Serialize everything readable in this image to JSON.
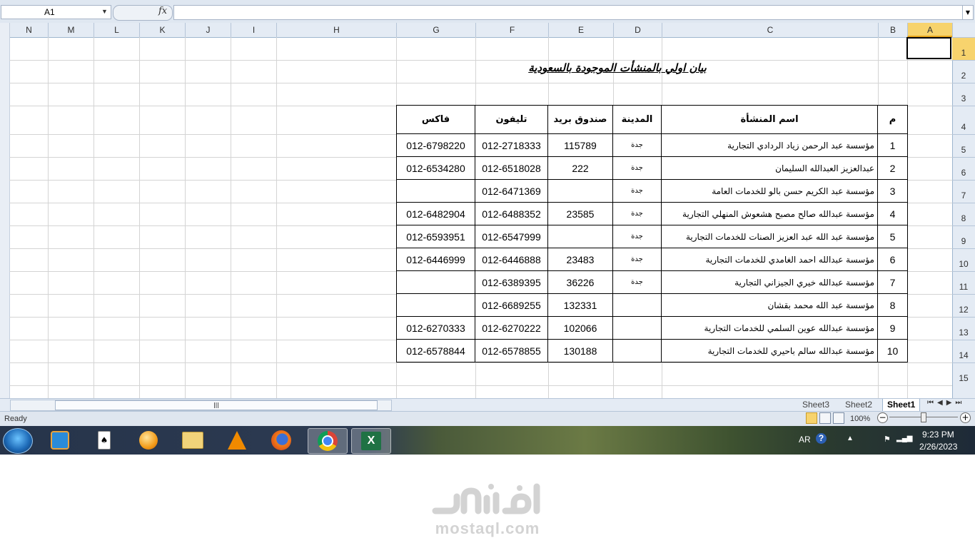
{
  "formula_bar": {
    "name_box": "A1",
    "fx_label": "fx",
    "formula": ""
  },
  "columns": [
    {
      "id": "N"
    },
    {
      "id": "M"
    },
    {
      "id": "L"
    },
    {
      "id": "K"
    },
    {
      "id": "J"
    },
    {
      "id": "I"
    },
    {
      "id": "H"
    },
    {
      "id": "G"
    },
    {
      "id": "F"
    },
    {
      "id": "E"
    },
    {
      "id": "D"
    },
    {
      "id": "C"
    },
    {
      "id": "B"
    },
    {
      "id": "A",
      "selected": true
    }
  ],
  "rows": [
    "1",
    "2",
    "3",
    "4",
    "5",
    "6",
    "7",
    "8",
    "9",
    "10",
    "11",
    "12",
    "13",
    "14",
    "15"
  ],
  "sheet": {
    "title": "بيان اولي  بالمنشأت الموجودة بالسعودية",
    "headers": {
      "index": "م",
      "name": "اسم المنشأة",
      "city": "المدينة",
      "po_box": "صندوق بريد",
      "phone": "تليفون",
      "fax": "فاكس"
    },
    "records": [
      {
        "index": "1",
        "name": "مؤسسة عبد الرحمن زياد الردادي التجارية",
        "city": "جدة",
        "po_box": "115789",
        "phone": "012-2718333",
        "fax": "012-6798220"
      },
      {
        "index": "2",
        "name": "عبدالعزيز العبدالله السليمان",
        "city": "جدة",
        "po_box": "222",
        "phone": "012-6518028",
        "fax": "012-6534280"
      },
      {
        "index": "3",
        "name": "مؤسسة عبد الكريم حسن بالو للخدمات العامة",
        "city": "جدة",
        "po_box": "",
        "phone": "012-6471369",
        "fax": ""
      },
      {
        "index": "4",
        "name": "مؤسسة عبدالله صالح مصبح هشعوش المنهلي التجارية",
        "city": "جدة",
        "po_box": "23585",
        "phone": "012-6488352",
        "fax": "012-6482904"
      },
      {
        "index": "5",
        "name": "مؤسسة عبد الله عبد العزيز الصنات للخدمات التجارية",
        "city": "جدة",
        "po_box": "",
        "phone": "012-6547999",
        "fax": "012-6593951"
      },
      {
        "index": "6",
        "name": "مؤسسة عبدالله احمد الغامدي للخدمات التجارية",
        "city": "جدة",
        "po_box": "23483",
        "phone": "012-6446888",
        "fax": "012-6446999"
      },
      {
        "index": "7",
        "name": "مؤسسة عبدالله خيري الجيزاني التجارية",
        "city": "جدة",
        "po_box": "36226",
        "phone": "012-6389395",
        "fax": ""
      },
      {
        "index": "8",
        "name": "مؤسسة عبد الله محمد بقشان",
        "city": "",
        "po_box": "132331",
        "phone": "012-6689255",
        "fax": ""
      },
      {
        "index": "9",
        "name": "مؤسسة عبدالله عوين السلمي للخدمات التجارية",
        "city": "",
        "po_box": "102066",
        "phone": "012-6270222",
        "fax": "012-6270333"
      },
      {
        "index": "10",
        "name": "مؤسسة عبدالله سالم باحيري للخدمات التجارية",
        "city": "",
        "po_box": "130188",
        "phone": "012-6578855",
        "fax": "012-6578844"
      }
    ]
  },
  "sheet_tabs": [
    {
      "label": "Sheet3"
    },
    {
      "label": "Sheet2"
    },
    {
      "label": "Sheet1",
      "active": true
    }
  ],
  "status_bar": {
    "status": "Ready",
    "zoom": "100%"
  },
  "taskbar": {
    "apps": [
      {
        "icon": "windows-media-center-icon"
      },
      {
        "icon": "solitaire-icon"
      },
      {
        "icon": "photo-viewer-icon"
      },
      {
        "icon": "file-explorer-icon"
      },
      {
        "icon": "vlc-icon"
      },
      {
        "icon": "firefox-icon"
      },
      {
        "icon": "chrome-icon",
        "active": true
      },
      {
        "icon": "excel-icon",
        "active": true
      }
    ],
    "language": "AR",
    "time": "9:23 PM",
    "date": "2/26/2023"
  },
  "watermark": {
    "logo_text": "مستقل",
    "url": "mostaql.com"
  },
  "colors": {
    "header_bg": "#e4ebf4",
    "selected_header": "#f7d36d",
    "grid": "#d4d4d4",
    "excel_green": "#1f7244"
  }
}
